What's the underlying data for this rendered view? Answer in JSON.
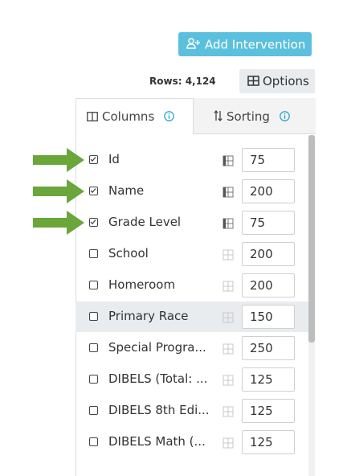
{
  "toolbar": {
    "add_intervention_label": "Add Intervention",
    "rows_text": "Rows: 4,124",
    "options_label": "Options"
  },
  "tabs": [
    {
      "label": "Columns",
      "icon": "columns-icon"
    },
    {
      "label": "Sorting",
      "icon": "sort-icon"
    }
  ],
  "columns": [
    {
      "label": "Id",
      "checked": true,
      "width": "75",
      "pointed": true
    },
    {
      "label": "Name",
      "checked": true,
      "width": "200",
      "pointed": true
    },
    {
      "label": "Grade Level",
      "checked": true,
      "width": "75",
      "pointed": true
    },
    {
      "label": "School",
      "checked": false,
      "width": "200"
    },
    {
      "label": "Homeroom",
      "checked": false,
      "width": "200"
    },
    {
      "label": "Primary Race",
      "checked": false,
      "width": "150",
      "highlighted": true
    },
    {
      "label": "Special Progra...",
      "checked": false,
      "width": "250"
    },
    {
      "label": "DIBELS (Total: ...",
      "checked": false,
      "width": "125"
    },
    {
      "label": "DIBELS 8th Edi...",
      "checked": false,
      "width": "125"
    },
    {
      "label": "DIBELS Math (...",
      "checked": false,
      "width": "125"
    }
  ],
  "colors": {
    "accent": "#5bc0de",
    "info_icon": "#2aa9d2",
    "arrow": "#6aa63a",
    "row_highlight": "#e8ecef"
  }
}
